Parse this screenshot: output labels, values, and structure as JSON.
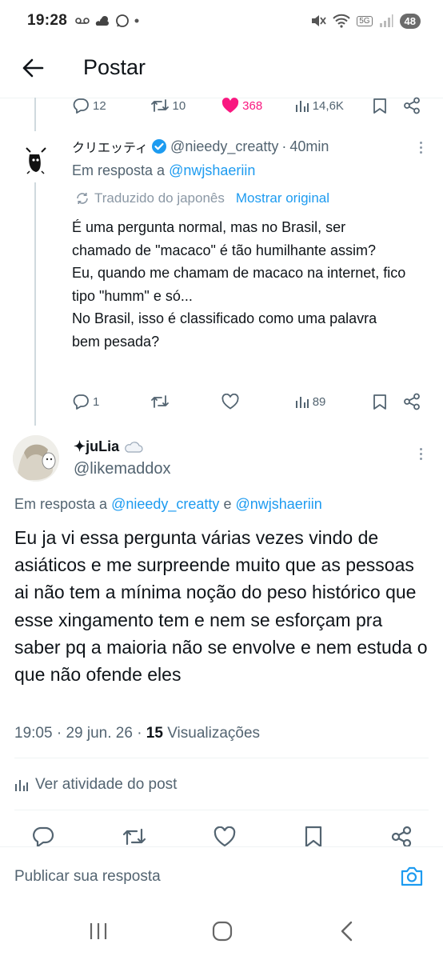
{
  "status_bar": {
    "time": "19:28",
    "network": "5G",
    "battery": "48"
  },
  "header": {
    "title": "Postar"
  },
  "parent_tweet_actions": {
    "replies": "12",
    "reposts": "10",
    "likes": "368",
    "views": "14,6K"
  },
  "reply_tweet": {
    "display_name": "クリエッティ",
    "handle": "@nieedy_creatty",
    "separator": "·",
    "time": "40min",
    "reply_prefix": "Em resposta a",
    "reply_to": "@nwjshaeriin",
    "translated_label": "Traduzido do japonês",
    "show_original": "Mostrar original",
    "body": "É uma pergunta normal, mas no Brasil, ser chamado de \"macaco\" é tão humilhante assim?\nEu, quando me chamam de macaco na internet, fico tipo \"humm\" e só...\nNo Brasil, isso é classificado como uma palavra bem pesada?",
    "replies": "1",
    "views": "89"
  },
  "main_tweet": {
    "display_name": "✦juLia",
    "handle": "@likemaddox",
    "reply_prefix": "Em resposta a",
    "reply_to_1": "@nieedy_creatty",
    "reply_joiner": "e",
    "reply_to_2": "@nwjshaeriin",
    "body": "Eu ja vi essa pergunta várias vezes vindo de asiáticos e me surpreende muito que as pessoas ai não tem a mínima noção do peso histórico que esse xingamento tem e nem se esforçam pra saber pq a maioria não se envolve e nem estuda o que não ofende eles",
    "time": "19:05",
    "date": "29 jun. 26",
    "views_count": "15",
    "views_label": "Visualizações",
    "activity_label": "Ver atividade do post"
  },
  "composer": {
    "placeholder": "Publicar sua resposta"
  },
  "colors": {
    "accent": "#1d9bf0",
    "like": "#f91880",
    "muted": "#536471",
    "verified": "#1d9bf0"
  },
  "icons": [
    "back-arrow-icon",
    "reply-icon",
    "repost-icon",
    "heart-icon",
    "views-icon",
    "bookmark-icon",
    "share-icon",
    "more-icon",
    "verified-icon",
    "translate-icon",
    "cloud-icon",
    "camera-icon",
    "recent-apps-icon",
    "home-icon",
    "nav-back-icon"
  ]
}
